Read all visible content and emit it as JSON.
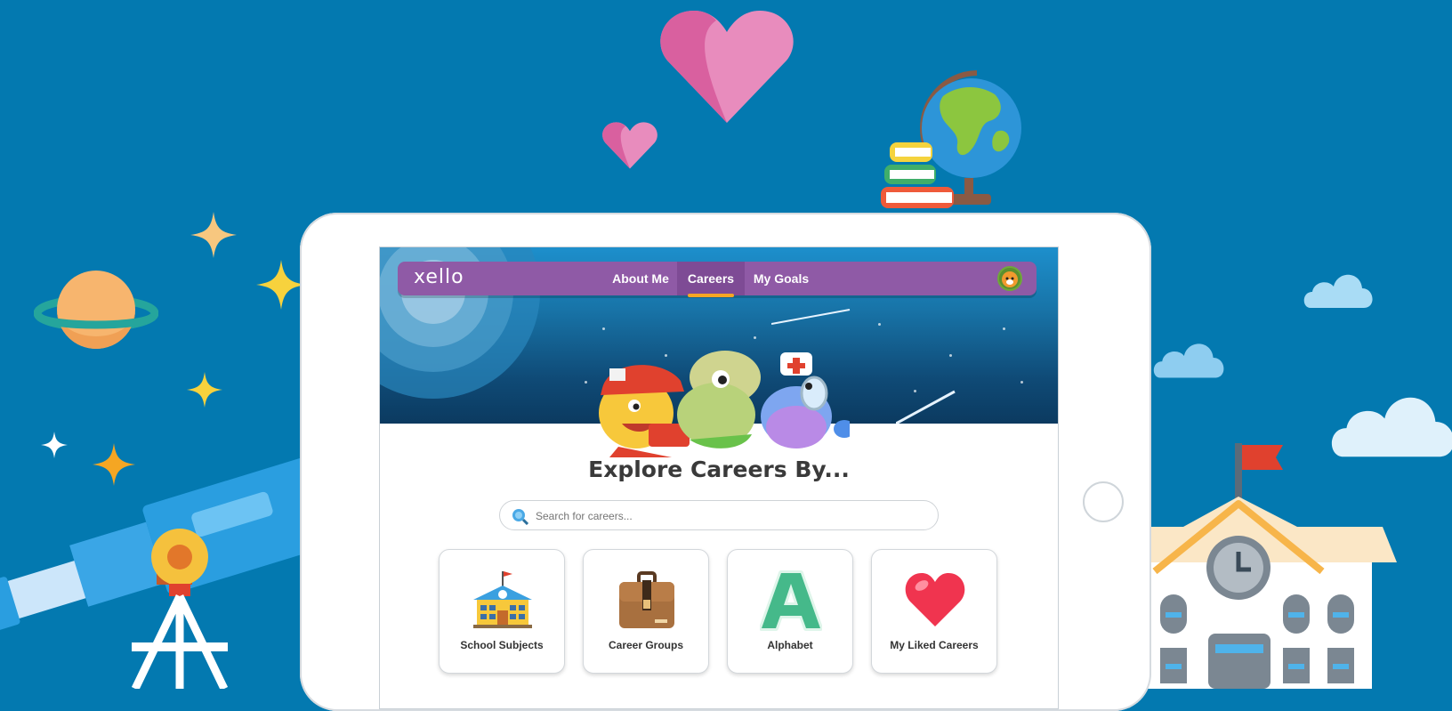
{
  "nav": {
    "logo": "xello",
    "items": [
      {
        "label": "About Me",
        "active": false
      },
      {
        "label": "Careers",
        "active": true
      },
      {
        "label": "My Goals",
        "active": false
      }
    ]
  },
  "main": {
    "title": "Explore Careers By...",
    "search_placeholder": "Search for careers...",
    "cards": [
      {
        "label": "School Subjects",
        "icon": "school-icon"
      },
      {
        "label": "Career Groups",
        "icon": "briefcase-icon"
      },
      {
        "label": "Alphabet",
        "icon": "letter-a-icon"
      },
      {
        "label": "My Liked Careers",
        "icon": "heart-icon"
      }
    ]
  },
  "colors": {
    "background": "#0379b0",
    "nav_bar": "#8f5aa6",
    "active_underline": "#f5a623"
  }
}
